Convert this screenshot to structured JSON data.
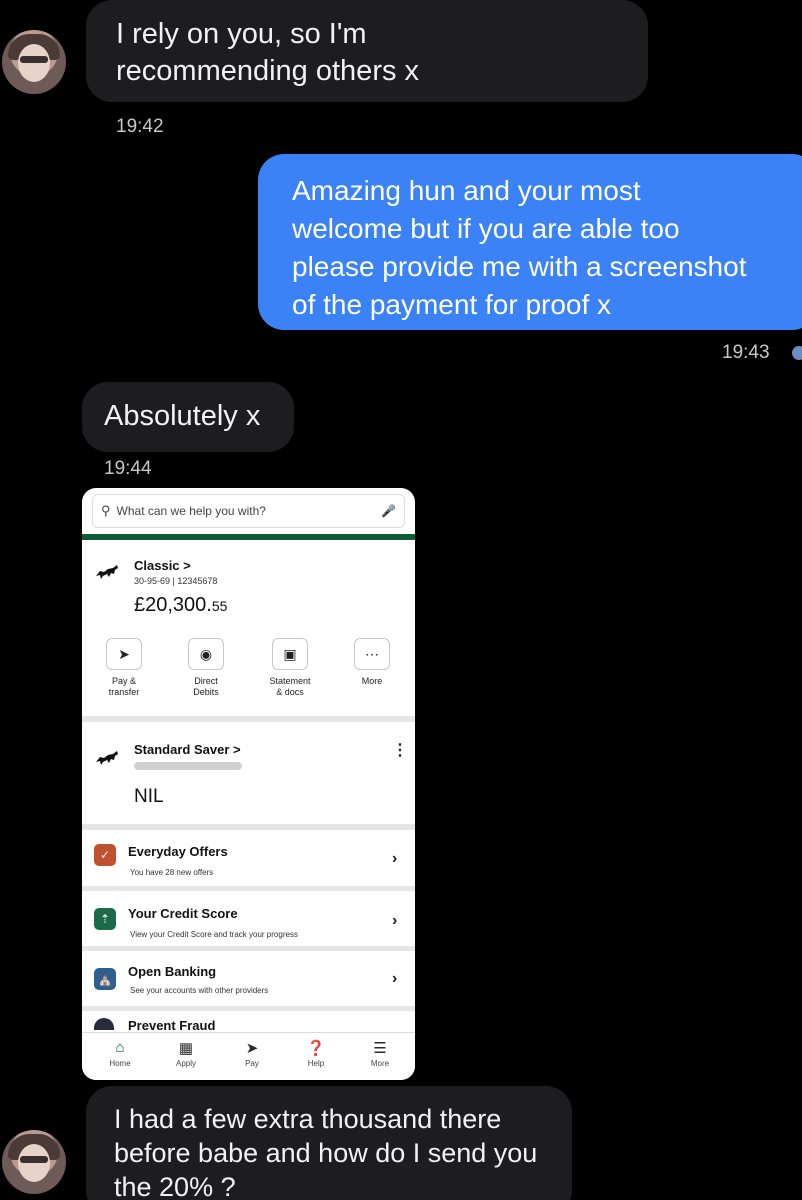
{
  "messages": [
    {
      "id": "m1",
      "direction": "incoming",
      "lines": [
        "I rely on you, so I'm",
        "recommending others x"
      ],
      "time": "19:42"
    },
    {
      "id": "m2",
      "direction": "outgoing",
      "lines": [
        "Amazing hun and your most",
        "welcome but if you are able too",
        "please provide me with a screenshot",
        "of the payment for proof x"
      ],
      "time": "19:43"
    },
    {
      "id": "m3",
      "direction": "incoming",
      "lines": [
        "Absolutely x"
      ],
      "time": "19:44"
    },
    {
      "id": "m5",
      "direction": "incoming",
      "lines": [
        "I had a few extra thousand there",
        "before babe and how do I send you",
        "the 20% ?"
      ]
    }
  ],
  "bank_screenshot": {
    "search_placeholder": "What can we help you with?",
    "account": {
      "name": "Classic >",
      "sort_and_number": "30-95-69 | 12345678",
      "balance_main": "£20,300.",
      "balance_pence": "55"
    },
    "quick_actions": [
      {
        "icon": "pay-transfer-icon",
        "label_lines": [
          "Pay &",
          "transfer"
        ]
      },
      {
        "icon": "direct-debits-icon",
        "label_lines": [
          "Direct",
          "Debits"
        ]
      },
      {
        "icon": "statement-icon",
        "label_lines": [
          "Statement",
          "& docs"
        ]
      },
      {
        "icon": "more-dots-icon",
        "label_lines": [
          "More"
        ]
      }
    ],
    "saver": {
      "name": "Standard Saver >",
      "balance": "NIL"
    },
    "rows": [
      {
        "title": "Everyday Offers",
        "subtitle": "You have 28 new offers",
        "icon": "offers-icon",
        "color": "#c0502f"
      },
      {
        "title": "Your Credit Score",
        "subtitle": "View your Credit Score and track your progress",
        "icon": "credit-score-icon",
        "color": "#1b6b4a"
      },
      {
        "title": "Open Banking",
        "subtitle": "See your accounts with other providers",
        "icon": "bank-icon",
        "color": "#2f5f8f"
      }
    ],
    "partial_row": "Prevent Fraud",
    "tabs": [
      "Home",
      "Apply",
      "Pay",
      "Help",
      "More"
    ]
  }
}
